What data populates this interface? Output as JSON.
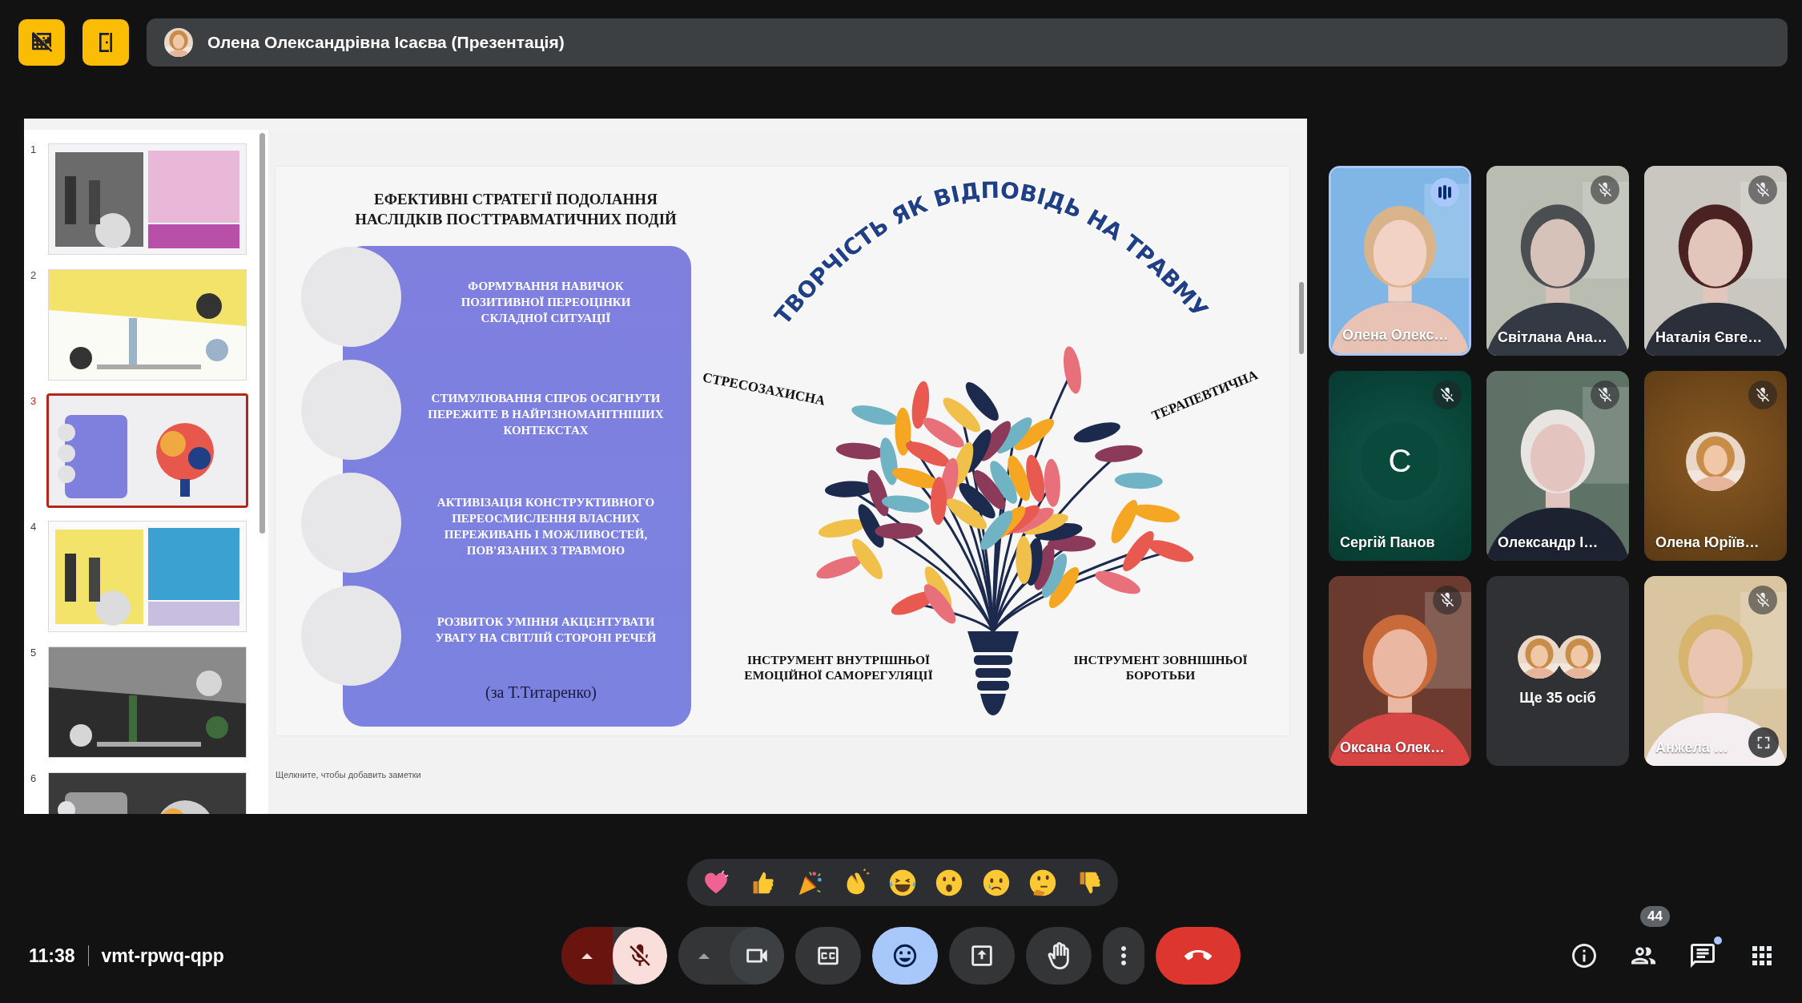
{
  "top_buttons": [
    {
      "kind": "grid-off"
    },
    {
      "kind": "door"
    }
  ],
  "presenter": {
    "title": "Олена Олександрівна Ісаєва (Презентація)"
  },
  "slides": [
    {
      "number": "1",
      "selected": false
    },
    {
      "number": "2",
      "selected": false
    },
    {
      "number": "3",
      "selected": true
    },
    {
      "number": "4",
      "selected": false
    },
    {
      "number": "5",
      "selected": false
    },
    {
      "number": "6",
      "selected": false
    }
  ],
  "slide": {
    "title_lines": [
      "ЕФЕКТИВНІ СТРАТЕГІЇ ПОДОЛАННЯ",
      "НАСЛІДКІВ ПОСТТРАВМАТИЧНИХ ПОДІЙ"
    ],
    "items": [
      {
        "lines": [
          "ФОРМУВАННЯ НАВИЧОК",
          "ПОЗИТИВНОЇ ПЕРЕОЦІНКИ",
          "СКЛАДНОЇ СИТУАЦІЇ"
        ]
      },
      {
        "lines": [
          "СТИМУЛЮВАННЯ СПРОБ ОСЯГНУТИ",
          "ПЕРЕЖИТЕ В НАЙРІЗНОМАНІТНІШИХ",
          "КОНТЕКСТАХ"
        ]
      },
      {
        "lines": [
          "АКТИВІЗАЦІЯ КОНСТРУКТИВНОГО",
          "ПЕРЕОСМИСЛЕННЯ ВЛАСНИХ",
          "ПЕРЕЖИВАНЬ І МОЖЛИВОСТЕЙ,",
          "ПОВ'ЯЗАНИХ З ТРАВМОЮ"
        ]
      },
      {
        "lines": [
          "РОЗВИТОК УМІННЯ АКЦЕНТУВАТИ",
          "УВАГУ НА СВІТЛІЙ СТОРОНІ РЕЧЕЙ"
        ]
      }
    ],
    "citation": "(за Т.Титаренко)",
    "arc_title": "ТВОРЧІСТЬ ЯК ВІДПОВІДЬ НА ТРАВМУ",
    "left_label": "СТРЕСОЗАХИСНА",
    "right_label": "ТЕРАПЕВТИЧНА",
    "bottom_labels": [
      {
        "lines": [
          "ІНСТРУМЕНТ ВНУТРІШНЬОЇ",
          "ЕМОЦІЙНОЇ САМОРЕГУЛЯЦІЇ"
        ]
      },
      {
        "lines": [
          "ІНСТРУМЕНТ ЗОВНІШНЬОЇ",
          "БОРОТЬБИ"
        ]
      }
    ]
  },
  "notes": {
    "placeholder": "Щелкните, чтобы добавить заметки"
  },
  "participants": [
    {
      "kind": "video",
      "name": "Олена Олекс…",
      "muted": false,
      "speaking": true,
      "hovered": false
    },
    {
      "kind": "video",
      "name": "Світлана Ана…",
      "muted": true,
      "speaking": false,
      "hovered": false
    },
    {
      "kind": "video",
      "name": "Наталія Євге…",
      "muted": true,
      "speaking": false,
      "hovered": false
    },
    {
      "kind": "letter",
      "name": "Сергій Панов",
      "initial": "С",
      "color": "#0e5a4b",
      "muted": true,
      "speaking": false,
      "hovered": false
    },
    {
      "kind": "video",
      "name": "Олександр І…",
      "muted": true,
      "speaking": false,
      "hovered": false
    },
    {
      "kind": "avatar",
      "name": "Олена Юріїв…",
      "color": "#8a5a22",
      "muted": true,
      "speaking": false,
      "hovered": false
    },
    {
      "kind": "video",
      "name": "Оксана Олек…",
      "muted": true,
      "speaking": false,
      "hovered": false
    },
    {
      "kind": "more",
      "label": "Ще 35 осіб"
    },
    {
      "kind": "video",
      "name": "Анжела …",
      "muted": true,
      "speaking": false,
      "hovered": true
    }
  ],
  "reactions": [
    {
      "kind": "heart"
    },
    {
      "kind": "thumbs-up"
    },
    {
      "kind": "party"
    },
    {
      "kind": "clap"
    },
    {
      "kind": "laugh"
    },
    {
      "kind": "surprised"
    },
    {
      "kind": "sad"
    },
    {
      "kind": "thinking"
    },
    {
      "kind": "thumbs-down"
    }
  ],
  "meeting": {
    "time": "11:38",
    "code": "vmt-rpwq-qpp"
  },
  "controls": [
    {
      "kind": "mic",
      "active": false
    },
    {
      "kind": "camera",
      "active": true
    },
    {
      "kind": "captions",
      "active": false
    },
    {
      "kind": "reactions",
      "active": true
    },
    {
      "kind": "present",
      "active": false
    },
    {
      "kind": "hand",
      "active": false
    },
    {
      "kind": "more",
      "active": false
    },
    {
      "kind": "leave",
      "active": false
    }
  ],
  "side_buttons": [
    {
      "kind": "info",
      "unread": false
    },
    {
      "kind": "people",
      "badge": "44",
      "unread": false
    },
    {
      "kind": "chat",
      "unread": true
    },
    {
      "kind": "apps",
      "unread": false
    }
  ]
}
